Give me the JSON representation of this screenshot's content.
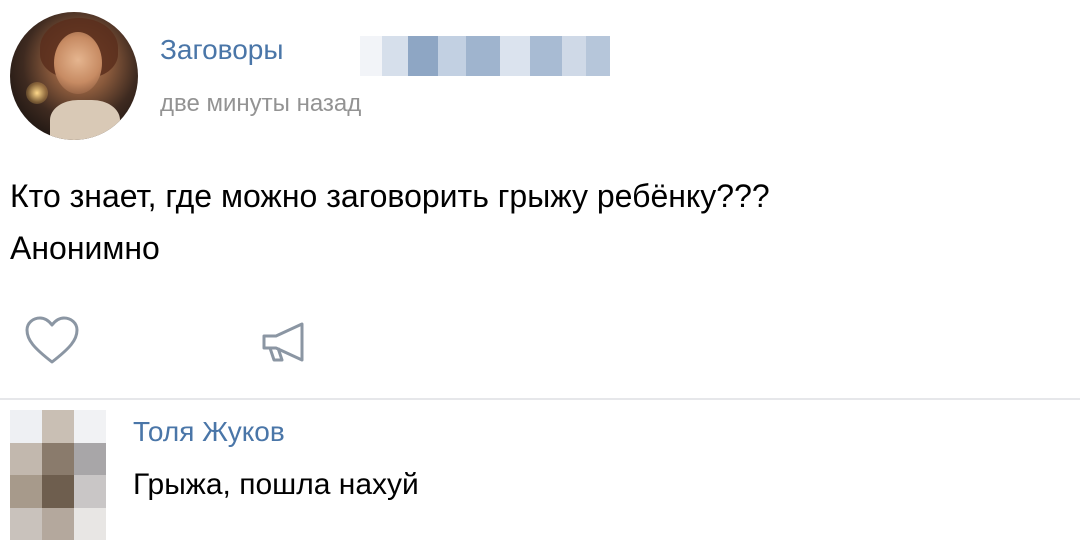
{
  "post": {
    "group_name": "Заговоры",
    "time": "две минуты назад",
    "text_lines": [
      "Кто знает, где можно заговорить грыжу ребёнку???",
      "Анонимно"
    ]
  },
  "comment": {
    "author": "Толя Жуков",
    "text": "Грыжа, пошла нахуй"
  },
  "colors": {
    "link": "#4a76a8",
    "secondary_text": "#939393",
    "icon": "#8b96a3",
    "divider": "#e6e7ea"
  },
  "icons": {
    "like": "heart-icon",
    "share": "megaphone-icon"
  }
}
